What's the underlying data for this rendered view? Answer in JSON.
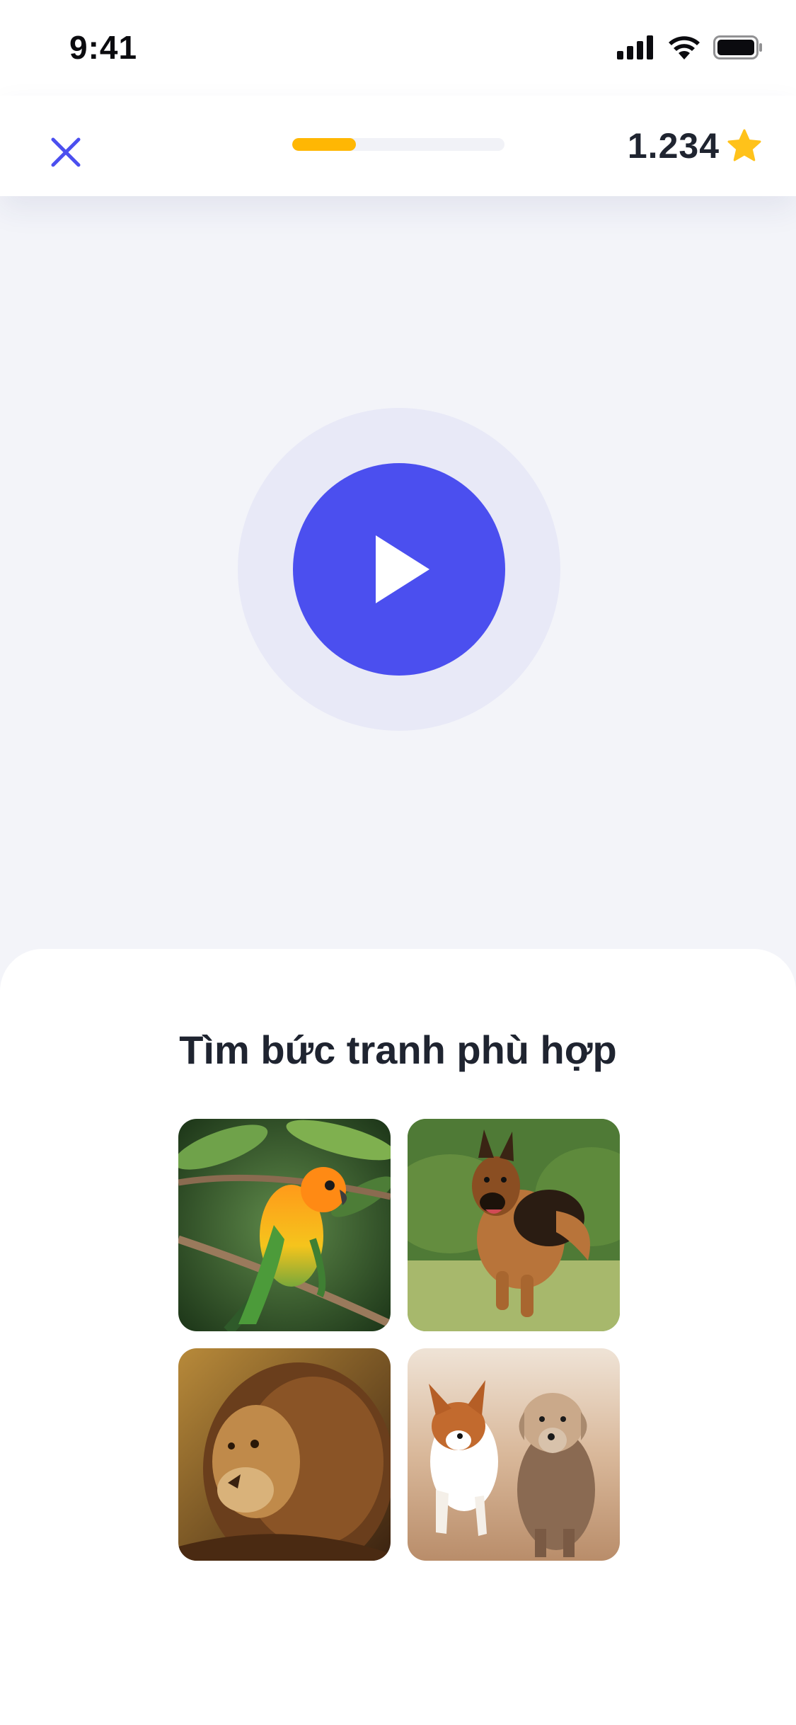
{
  "status_bar": {
    "time": "9:41",
    "icons": [
      "signal-icon",
      "wifi-icon",
      "battery-icon"
    ]
  },
  "header": {
    "close_icon": "close-icon",
    "progress": 0.3,
    "score": "1.234",
    "score_icon": "star-icon"
  },
  "player": {
    "icon": "play-icon"
  },
  "question": {
    "prompt": "Tìm bức tranh phù hợp",
    "options": [
      {
        "subject": "parrot"
      },
      {
        "subject": "german-shepherd"
      },
      {
        "subject": "lion"
      },
      {
        "subject": "corgi-and-terrier"
      }
    ]
  },
  "colors": {
    "accent": "#4b4fef",
    "progress": "#ffb703",
    "background": "#f3f4f9",
    "star": "#ffc21a"
  }
}
